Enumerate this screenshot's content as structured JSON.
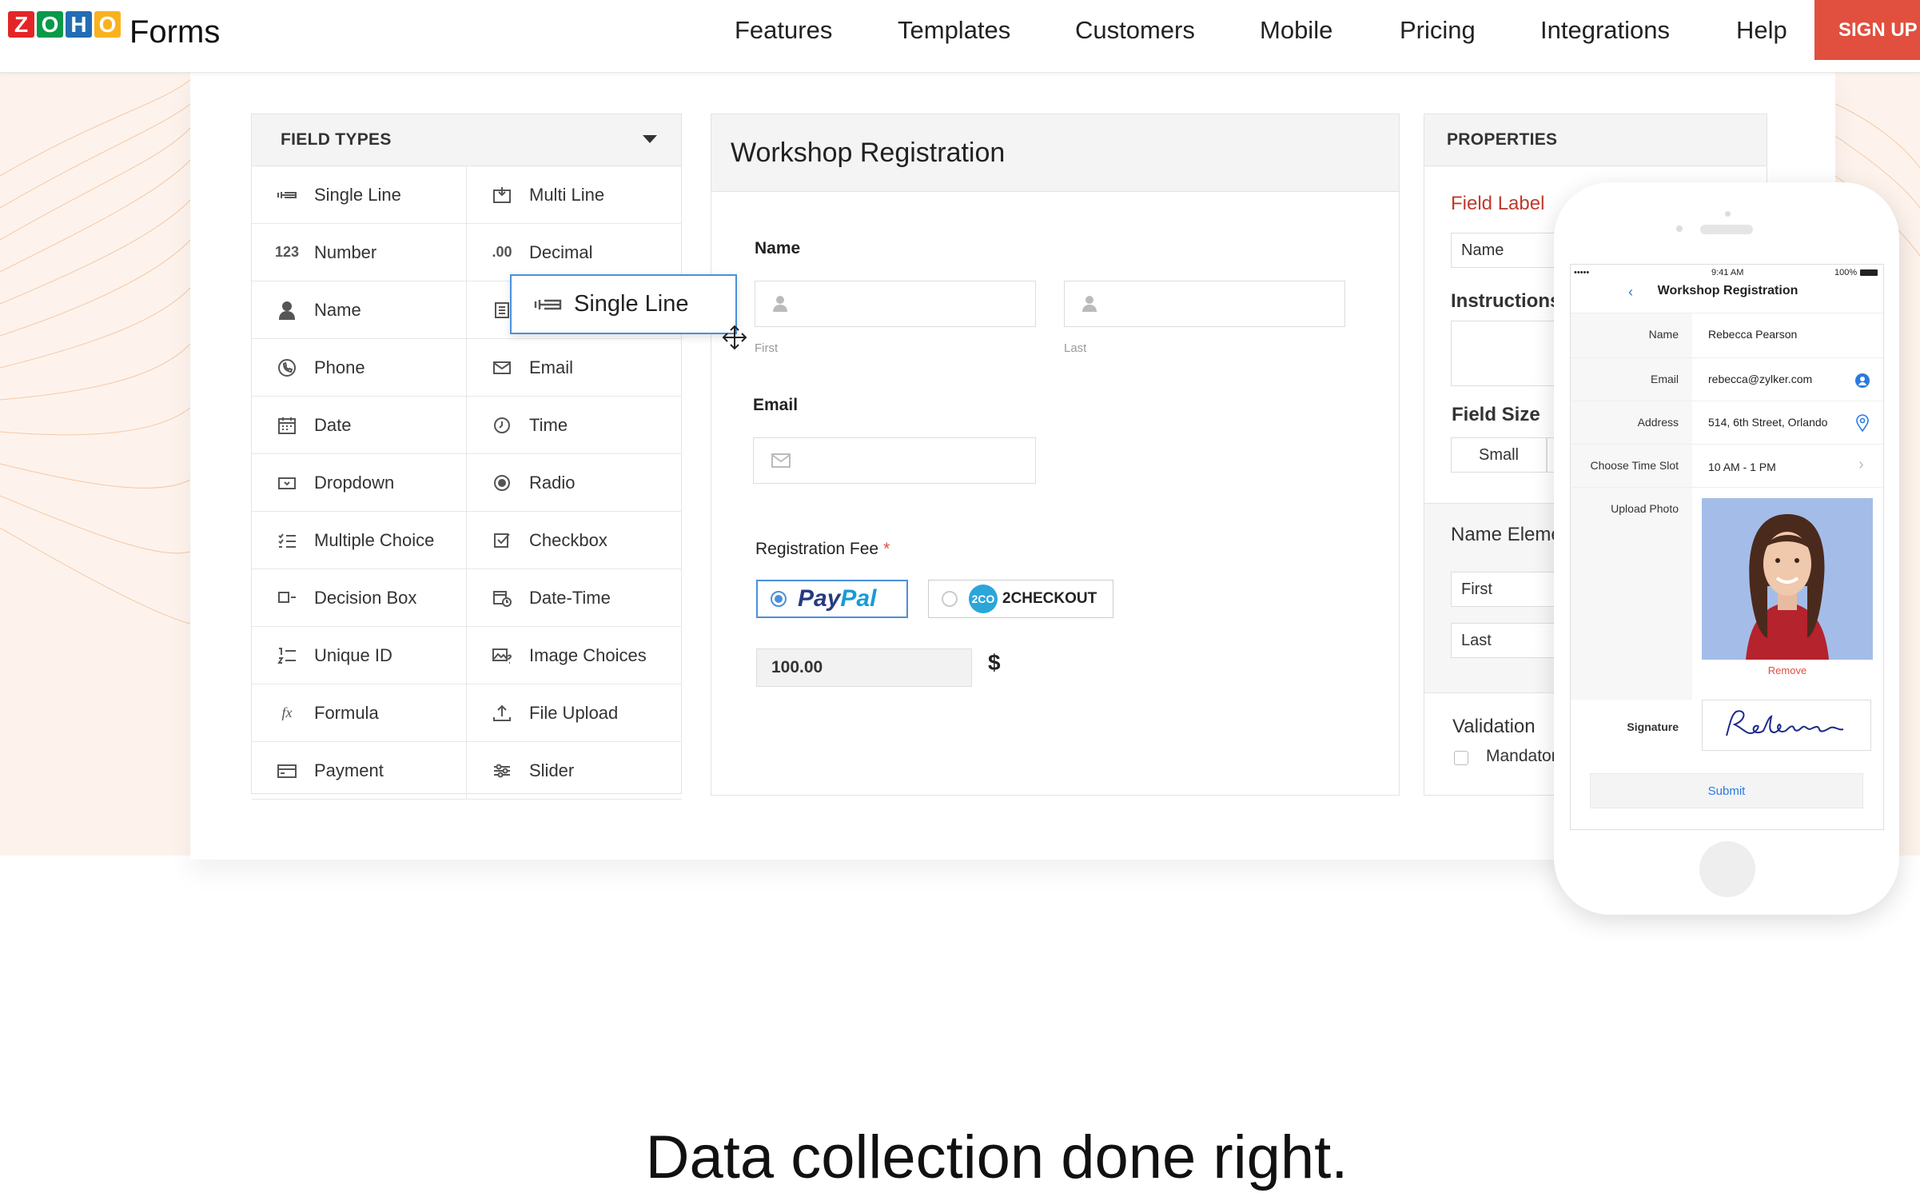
{
  "nav": {
    "logo_letters": [
      "Z",
      "O",
      "H",
      "O"
    ],
    "logo_colors": [
      "#e42527",
      "#089949",
      "#226db4",
      "#f9b21d"
    ],
    "brand": "Forms",
    "links": [
      "Features",
      "Templates",
      "Customers",
      "Mobile",
      "Pricing",
      "Integrations",
      "Help"
    ],
    "signup": "SIGN UP N"
  },
  "field_types": {
    "title": "FIELD TYPES",
    "items": [
      {
        "label": "Single Line",
        "icon": "single-line-icon"
      },
      {
        "label": "Multi Line",
        "icon": "multi-line-icon"
      },
      {
        "label": "Number",
        "icon": "number-icon",
        "glyph": "123"
      },
      {
        "label": "Decimal",
        "icon": "decimal-icon",
        "glyph": ".00"
      },
      {
        "label": "Name",
        "icon": "person-icon"
      },
      {
        "label": "",
        "icon": "address-icon"
      },
      {
        "label": "Phone",
        "icon": "phone-icon"
      },
      {
        "label": "Email",
        "icon": "envelope-icon"
      },
      {
        "label": "Date",
        "icon": "calendar-icon"
      },
      {
        "label": "Time",
        "icon": "clock-icon"
      },
      {
        "label": "Dropdown",
        "icon": "dropdown-icon"
      },
      {
        "label": "Radio",
        "icon": "radio-icon"
      },
      {
        "label": "Multiple Choice",
        "icon": "multiple-choice-icon"
      },
      {
        "label": "Checkbox",
        "icon": "checkbox-icon"
      },
      {
        "label": "Decision Box",
        "icon": "decision-box-icon"
      },
      {
        "label": "Date-Time",
        "icon": "date-time-icon"
      },
      {
        "label": "Unique ID",
        "icon": "unique-id-icon"
      },
      {
        "label": "Image Choices",
        "icon": "image-choices-icon"
      },
      {
        "label": "Formula",
        "icon": "formula-icon",
        "glyph": "fx"
      },
      {
        "label": "File Upload",
        "icon": "upload-icon"
      },
      {
        "label": "Payment",
        "icon": "card-icon"
      },
      {
        "label": "Slider",
        "icon": "slider-icon"
      }
    ],
    "drag_label": "Single Line"
  },
  "form": {
    "title": "Workshop Registration",
    "name_label": "Name",
    "first_sub": "First",
    "last_sub": "Last",
    "email_label": "Email",
    "fee_label": "Registration Fee",
    "required_mark": "*",
    "paypal_a": "Pay",
    "paypal_b": "Pal",
    "checkout_badge": "2CO",
    "checkout_label": "2CHECKOUT",
    "amount": "100.00",
    "currency": "$"
  },
  "properties": {
    "title": "PROPERTIES",
    "field_label": "Field Label",
    "field_label_value": "Name",
    "instructions": "Instructions",
    "field_size": "Field  Size",
    "size_value": "Small",
    "name_elements": "Name Eleme",
    "first": "First",
    "last": "Last",
    "validation": "Validation",
    "mandatory": "Mandator"
  },
  "phone": {
    "signal": "••••• ",
    "time": "9:41 AM",
    "battery": "100%",
    "title": "Workshop Registration",
    "rows": [
      {
        "label": "Name",
        "value": "Rebecca Pearson"
      },
      {
        "label": "Email",
        "value": "rebecca@zylker.com"
      },
      {
        "label": "Address",
        "value": "514, 6th Street, Orlando"
      },
      {
        "label": "Choose Time Slot",
        "value": "10 AM - 1 PM"
      },
      {
        "label": "Upload Photo",
        "value": ""
      }
    ],
    "remove": "Remove",
    "signature_label": "Signature",
    "signature_text": "Rebecca",
    "submit": "Submit"
  },
  "tagline": "Data collection done right.",
  "colors": {
    "accent": "#e14f3e",
    "blue": "#4a90d9",
    "paypal_dark": "#253b80",
    "paypal_light": "#179bd7"
  }
}
